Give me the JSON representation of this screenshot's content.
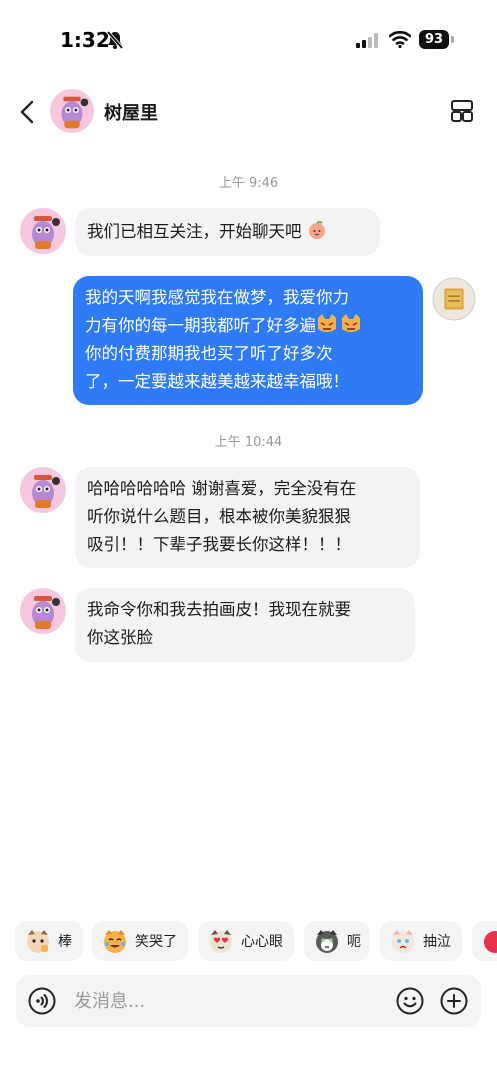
{
  "status_bar": {
    "time": "1:32",
    "battery": "93"
  },
  "header": {
    "title": "树屋里"
  },
  "messages": [
    {
      "timestamp": "上午 9:46"
    },
    {
      "text": "我们已相互关注，开始聊天吧"
    },
    {
      "lines": [
        "我的天啊我感觉我在做梦，我爱你力",
        "力有你的每一期我都听了好多遍",
        "你的付费那期我也买了听了好多次",
        "了，一定要越来越美越来越幸福哦！"
      ]
    },
    {
      "timestamp": "上午 10:44"
    },
    {
      "lines": [
        "哈哈哈哈哈哈 谢谢喜爱，完全没有在",
        "听你说什么题目，根本被你美貌狠狠",
        "吸引！！下辈子我要长你这样！！！"
      ]
    },
    {
      "lines": [
        "我命令你和我去拍画皮！我现在就要",
        "你这张脸"
      ]
    }
  ],
  "quick_replies": [
    "棒",
    "笑哭了",
    "心心眼",
    "呃",
    "抽泣"
  ],
  "input": {
    "placeholder": "发消息..."
  },
  "icons": {
    "back": "chevron-left-icon",
    "layout": "layout-grid-icon",
    "voice": "voice-icon",
    "emoji": "emoji-icon",
    "plus": "plus-icon",
    "mute": "bell-slash-icon"
  },
  "colors": {
    "outgoing_bubble": "#2f7bf5",
    "incoming_bubble": "#f3f3f4",
    "avatar_bg": "#f7c7df"
  }
}
